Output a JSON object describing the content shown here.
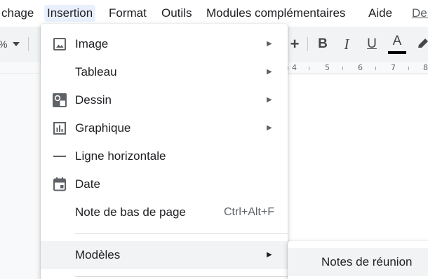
{
  "menubar": {
    "items": [
      "chage",
      "Insertion",
      "Format",
      "Outils",
      "Modules complémentaires",
      "Aide"
    ],
    "last_edit_link": "Der"
  },
  "toolbar": {
    "zoom_suffix": "%",
    "plus": "+",
    "bold": "B",
    "italic": "I",
    "underline": "U",
    "text_color": "A",
    "text_color_value": "#000000"
  },
  "ruler": {
    "numbers": [
      "4",
      "5",
      "6",
      "7",
      "8"
    ]
  },
  "insert_menu": {
    "items": [
      {
        "label": "Image",
        "icon": "image-icon",
        "has_submenu": true
      },
      {
        "label": "Tableau",
        "icon": "",
        "has_submenu": true
      },
      {
        "label": "Dessin",
        "icon": "drawing-icon",
        "has_submenu": true
      },
      {
        "label": "Graphique",
        "icon": "chart-icon",
        "has_submenu": true
      },
      {
        "label": "Ligne horizontale",
        "icon": "horizontal-line-icon",
        "has_submenu": false
      },
      {
        "label": "Date",
        "icon": "calendar-icon",
        "has_submenu": false
      },
      {
        "label": "Note de bas de page",
        "icon": "",
        "has_submenu": false,
        "shortcut": "Ctrl+Alt+F"
      },
      {
        "label": "Modèles",
        "icon": "",
        "has_submenu": true,
        "highlighted": true
      }
    ]
  },
  "templates_submenu": {
    "items": [
      {
        "label": "Notes de réunion",
        "highlighted": true
      }
    ]
  },
  "colors": {
    "menu_active_bg": "#e8f0fe",
    "hover_bg": "#f1f3f4",
    "toolbar_bg": "#f1f3f4",
    "text": "#202124",
    "icon": "#5f6368"
  }
}
